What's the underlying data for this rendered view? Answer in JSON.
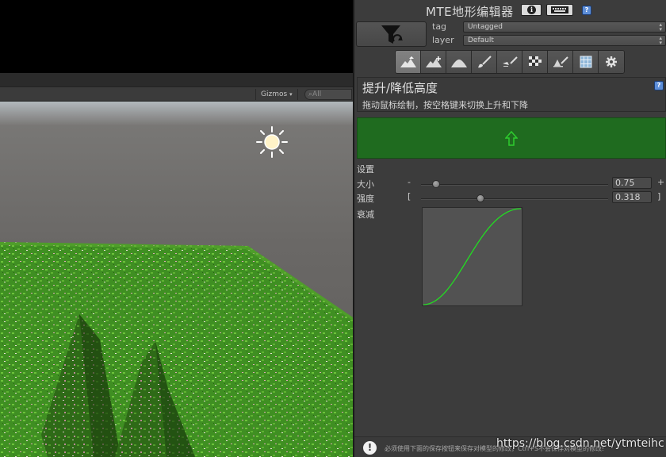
{
  "scene": {
    "toolbar": {
      "gizmos_label": "Gizmos",
      "gizmos_arrow": "▾",
      "search_placeholder": "All"
    }
  },
  "inspector": {
    "title": "MTE地形编辑器",
    "info_label": "i",
    "help_label": "?",
    "tag": {
      "label": "tag",
      "value": "Untagged"
    },
    "layer": {
      "label": "layer",
      "value": "Default"
    },
    "tools": [
      {
        "icon": "raise-lower-terrain-icon",
        "active": true
      },
      {
        "icon": "paint-height-icon",
        "active": false
      },
      {
        "icon": "smooth-terrain-icon",
        "active": false
      },
      {
        "icon": "paint-texture-brush-icon",
        "active": false
      },
      {
        "icon": "paint-details-icon",
        "active": false
      },
      {
        "icon": "texture-tiles-icon",
        "active": false
      },
      {
        "icon": "place-trees-icon",
        "active": false
      },
      {
        "icon": "grid-icon",
        "active": false
      },
      {
        "icon": "settings-gear-icon",
        "active": false
      }
    ],
    "tool_section": {
      "title": "提升/降低高度",
      "description": "拖动鼠标绘制，按空格键来切换上升和下降",
      "help_label": "?"
    },
    "mode_color": "#1f6b1f",
    "mode_arrow_color": "#2ecc2e",
    "settings": {
      "header": "设置",
      "size": {
        "label": "大小",
        "left_mark": "-",
        "right_mark": "+",
        "value": "0.75",
        "fraction": 0.08
      },
      "strength": {
        "label": "强度",
        "left_mark": "[",
        "right_mark": "]",
        "value": "0.318",
        "fraction": 0.318
      },
      "falloff": {
        "label": "衰减",
        "curve_color": "#22dd22"
      }
    },
    "status": {
      "message": "必须使用下面的保存按钮来保存对模型的修改，Ctrl+S不会保存对模型的修改!",
      "watermark": "https://blog.csdn.net/ytmteihc"
    }
  }
}
